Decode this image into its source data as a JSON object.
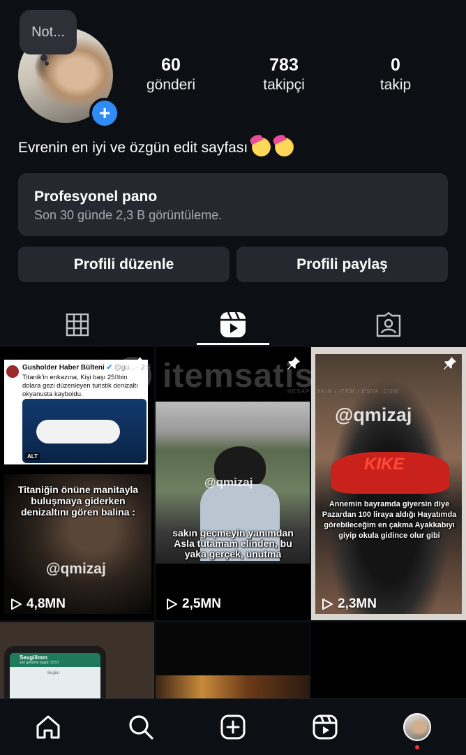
{
  "note": {
    "text": "Not..."
  },
  "profile": {
    "bio": "Evrenin en iyi ve özgün edit sayfası",
    "bio_emojis": [
      "face-with-party-horn",
      "face-with-party-horn"
    ]
  },
  "stats": [
    {
      "value": "60",
      "label": "gönderi"
    },
    {
      "value": "783",
      "label": "takipçi"
    },
    {
      "value": "0",
      "label": "takip"
    }
  ],
  "dashboard": {
    "title": "Profesyonel pano",
    "subtitle": "Son 30 günde 2,3 B görüntüleme."
  },
  "buttons": {
    "edit": "Profili düzenle",
    "share": "Profili paylaş"
  },
  "tabs": [
    "grid-icon",
    "reels-icon",
    "tagged-icon"
  ],
  "active_tab": "reels-icon",
  "watermark": {
    "text": "itemsatis",
    "tagline": "HESAP / SKIN / ITEM / ESYA .COM"
  },
  "reels": [
    {
      "tweet_author": "Gusholder Haber Bülteni",
      "tweet_handle": "@gu... · 2 F",
      "tweet_text": "Titanik'in enkazına, Kişi başı 250bin dolara gezi düzenleyen turistik denizaltı okyanusta kayboldu.",
      "tweet_badge": "ALT",
      "caption": "Titaniğin önüne manitayla buluşmaya giderken denizaltını gören balina :",
      "handle": "@qmizaj",
      "views": "4,8MN",
      "pinned": true
    },
    {
      "caption": "sakın geçmeyin yanımdan Asla tutamam elinden, bu yaka gerçek, unutma",
      "handle": "@qmizaj",
      "views": "2,5MN",
      "pinned": true
    },
    {
      "caption": "Annemin bayramda giyersin diye Pazardan 100 liraya aldığı Hayatımda görebileceğim en çakma Ayakkabıyı giyip okula gidince olur gibi",
      "handle": "@qmizaj",
      "shoe_logo": "KIKE",
      "views": "2,3MN",
      "pinned": true
    },
    {
      "chat_title": "Sevgilimm",
      "chat_subtitle": "son görülme bugün 15:57",
      "chat_day": "Bugün"
    },
    {},
    {}
  ],
  "colors": {
    "background": "#0c0f14",
    "card": "#25282e",
    "accent": "#2f8cf6",
    "notification": "#ff3040"
  },
  "nav": [
    "home-icon",
    "search-icon",
    "create-icon",
    "reels-icon",
    "profile-avatar"
  ]
}
